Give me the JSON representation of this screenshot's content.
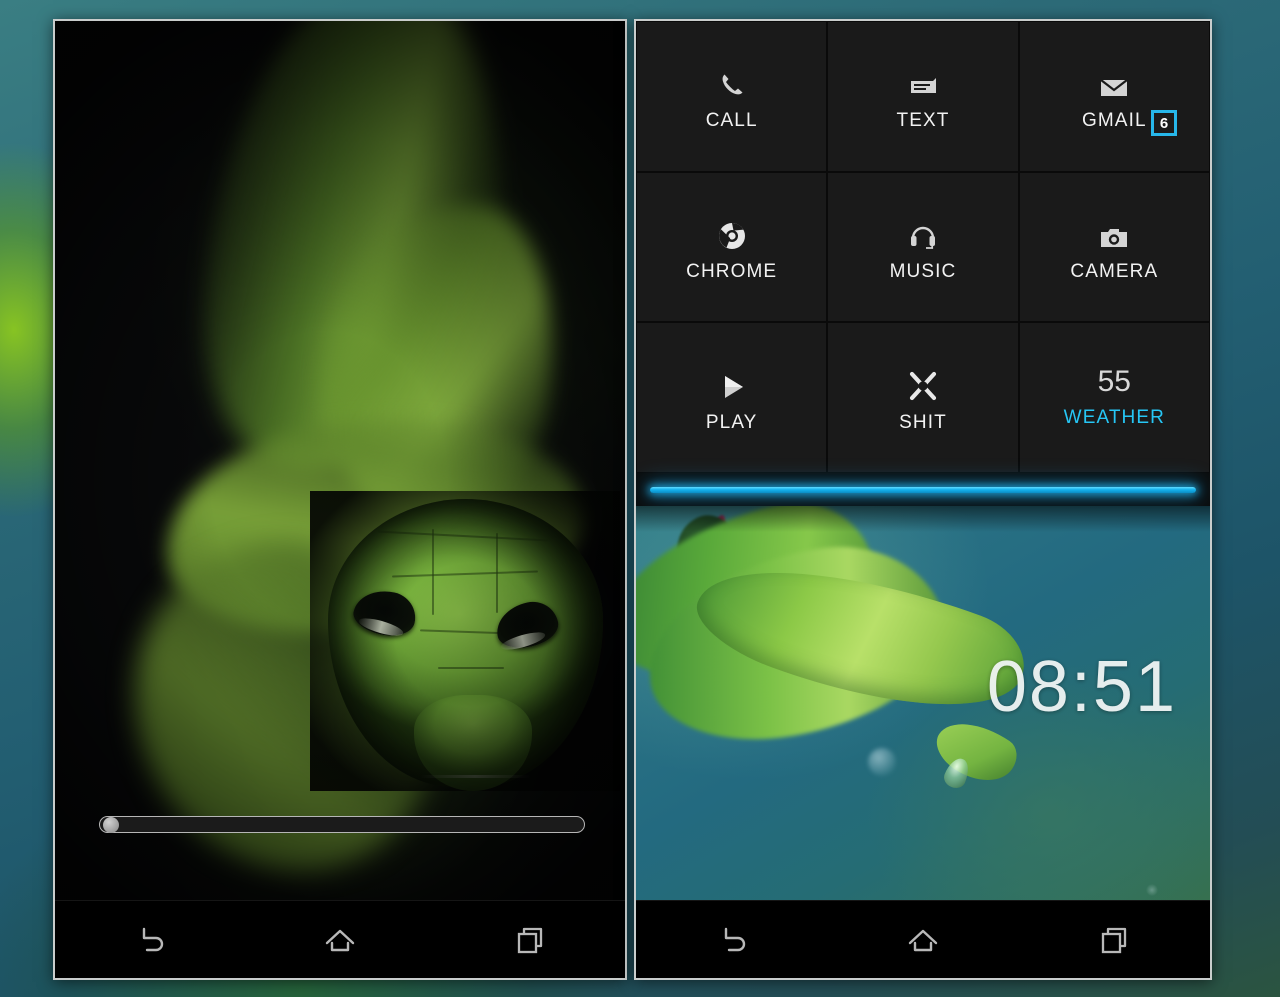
{
  "background": {
    "accent_teal": "#2d6b78",
    "accent_green": "#6fae28"
  },
  "left_phone": {
    "name": "snake-photo-viewer",
    "wallpaper_subject": "green-snake-head",
    "slider": {
      "name": "photo-position-slider",
      "value": 0,
      "min": 0,
      "max": 100
    },
    "navbar": {
      "back_label": "back-icon",
      "home_label": "home-icon",
      "recents_label": "recents-icon"
    }
  },
  "right_phone": {
    "name": "android-launcher",
    "tiles": [
      {
        "label": "CALL",
        "icon": "phone-icon",
        "accent": false,
        "badge": null,
        "value": null
      },
      {
        "label": "TEXT",
        "icon": "message-icon",
        "accent": false,
        "badge": null,
        "value": null
      },
      {
        "label": "GMAIL",
        "icon": "envelope-icon",
        "accent": false,
        "badge": "6",
        "value": null
      },
      {
        "label": "CHROME",
        "icon": "chrome-icon",
        "accent": false,
        "badge": null,
        "value": null
      },
      {
        "label": "MUSIC",
        "icon": "headphones-icon",
        "accent": false,
        "badge": null,
        "value": null
      },
      {
        "label": "CAMERA",
        "icon": "camera-icon",
        "accent": false,
        "badge": null,
        "value": null
      },
      {
        "label": "PLAY",
        "icon": "play-icon",
        "accent": false,
        "badge": null,
        "value": null
      },
      {
        "label": "SHIT",
        "icon": "x-cross-icon",
        "accent": false,
        "badge": null,
        "value": null
      },
      {
        "label": "WEATHER",
        "icon": null,
        "accent": true,
        "badge": null,
        "value": "55"
      }
    ],
    "divider": {
      "name": "cyan-glow-divider",
      "color": "#1ab4ee"
    },
    "lockscreen": {
      "clock": "08:51",
      "wallpaper_subject": "green-leaf-with-water-droplet"
    },
    "navbar": {
      "back_label": "back-icon",
      "home_label": "home-icon",
      "recents_label": "recents-icon"
    }
  }
}
